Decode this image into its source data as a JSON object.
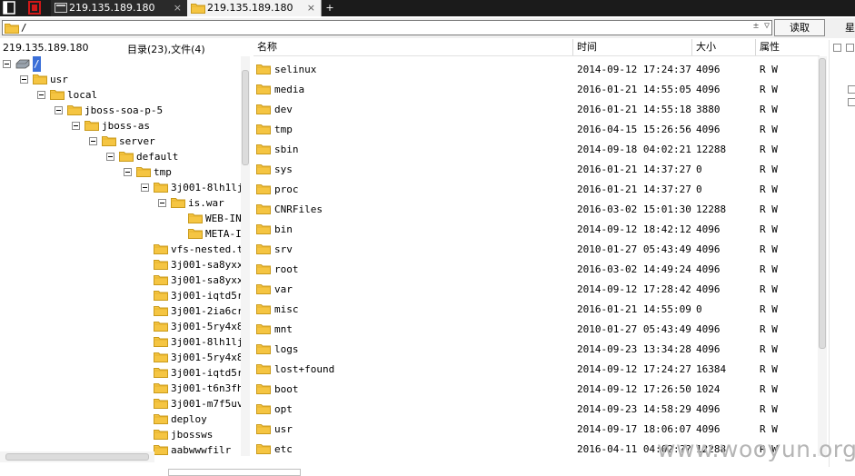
{
  "tabs": [
    {
      "label": "219.135.189.180",
      "active": false
    },
    {
      "label": "219.135.189.180",
      "active": true
    }
  ],
  "tab_close_glyph": "×",
  "tab_add_glyph": "+",
  "address": {
    "path": "/",
    "dropdown_glyph": "± ▽",
    "read_button": "读取",
    "side_char": "星"
  },
  "left_panel": {
    "host": "219.135.189.180",
    "dir_stats": "目录(23),文件(4)"
  },
  "tree": [
    {
      "label": "/",
      "depth": 0,
      "expanded": true,
      "icon": "drive-icon"
    },
    {
      "label": "usr",
      "depth": 1,
      "expanded": true
    },
    {
      "label": "local",
      "depth": 2,
      "expanded": true
    },
    {
      "label": "jboss-soa-p-5",
      "depth": 3,
      "expanded": true
    },
    {
      "label": "jboss-as",
      "depth": 4,
      "expanded": true
    },
    {
      "label": "server",
      "depth": 5,
      "expanded": true
    },
    {
      "label": "default",
      "depth": 6,
      "expanded": true
    },
    {
      "label": "tmp",
      "depth": 7,
      "expanded": true
    },
    {
      "label": "3j001-8lh1lj",
      "depth": 8,
      "expanded": true
    },
    {
      "label": "is.war",
      "depth": 9,
      "expanded": true
    },
    {
      "label": "WEB-IN",
      "depth": 10,
      "expanded": false
    },
    {
      "label": "META-I",
      "depth": 10,
      "expanded": false
    },
    {
      "label": "vfs-nested.tı",
      "depth": 8,
      "expanded": false
    },
    {
      "label": "3j001-sa8yxx",
      "depth": 8,
      "expanded": false
    },
    {
      "label": "3j001-sa8yxx",
      "depth": 8,
      "expanded": false
    },
    {
      "label": "3j001-iqtd5r",
      "depth": 8,
      "expanded": false
    },
    {
      "label": "3j001-2ia6cr",
      "depth": 8,
      "expanded": false
    },
    {
      "label": "3j001-5ry4x8",
      "depth": 8,
      "expanded": false
    },
    {
      "label": "3j001-8lh1lj",
      "depth": 8,
      "expanded": false
    },
    {
      "label": "3j001-5ry4x8",
      "depth": 8,
      "expanded": false
    },
    {
      "label": "3j001-iqtd5r",
      "depth": 8,
      "expanded": false
    },
    {
      "label": "3j001-t6n3fh",
      "depth": 8,
      "expanded": false
    },
    {
      "label": "3j001-m7f5uv",
      "depth": 8,
      "expanded": false
    },
    {
      "label": "deploy",
      "depth": 8,
      "expanded": false
    },
    {
      "label": "jbossws",
      "depth": 8,
      "expanded": false
    },
    {
      "label": "aabwwwfilr",
      "depth": 8,
      "expanded": false
    }
  ],
  "list_columns": {
    "name": "名称",
    "time": "时间",
    "size": "大小",
    "attr": "属性"
  },
  "files": [
    {
      "name": "selinux",
      "time": "2014-09-12 17:24:37",
      "size": "4096",
      "attr": "R W"
    },
    {
      "name": "media",
      "time": "2016-01-21 14:55:05",
      "size": "4096",
      "attr": "R W"
    },
    {
      "name": "dev",
      "time": "2016-01-21 14:55:18",
      "size": "3880",
      "attr": "R W"
    },
    {
      "name": "tmp",
      "time": "2016-04-15 15:26:56",
      "size": "4096",
      "attr": "R W"
    },
    {
      "name": "sbin",
      "time": "2014-09-18 04:02:21",
      "size": "12288",
      "attr": "R W"
    },
    {
      "name": "sys",
      "time": "2016-01-21 14:37:27",
      "size": "0",
      "attr": "R W"
    },
    {
      "name": "proc",
      "time": "2016-01-21 14:37:27",
      "size": "0",
      "attr": "R W"
    },
    {
      "name": "CNRFiles",
      "time": "2016-03-02 15:01:30",
      "size": "12288",
      "attr": "R W"
    },
    {
      "name": "bin",
      "time": "2014-09-12 18:42:12",
      "size": "4096",
      "attr": "R W"
    },
    {
      "name": "srv",
      "time": "2010-01-27 05:43:49",
      "size": "4096",
      "attr": "R W"
    },
    {
      "name": "root",
      "time": "2016-03-02 14:49:24",
      "size": "4096",
      "attr": "R W"
    },
    {
      "name": "var",
      "time": "2014-09-12 17:28:42",
      "size": "4096",
      "attr": "R W"
    },
    {
      "name": "misc",
      "time": "2016-01-21 14:55:09",
      "size": "0",
      "attr": "R W"
    },
    {
      "name": "mnt",
      "time": "2010-01-27 05:43:49",
      "size": "4096",
      "attr": "R W"
    },
    {
      "name": "logs",
      "time": "2014-09-23 13:34:28",
      "size": "4096",
      "attr": "R W"
    },
    {
      "name": "lost+found",
      "time": "2014-09-12 17:24:27",
      "size": "16384",
      "attr": "R W"
    },
    {
      "name": "boot",
      "time": "2014-09-12 17:26:50",
      "size": "1024",
      "attr": "R W"
    },
    {
      "name": "opt",
      "time": "2014-09-23 14:58:29",
      "size": "4096",
      "attr": "R W"
    },
    {
      "name": "usr",
      "time": "2014-09-17 18:06:07",
      "size": "4096",
      "attr": "R W"
    },
    {
      "name": "etc",
      "time": "2016-04-11 04:02:??",
      "size": "12288",
      "attr": "R W"
    }
  ],
  "watermark": "www.wooyun.org",
  "colors": {
    "folder": "#f5c542",
    "folder_edge": "#c99a1a",
    "titlebar": "#1b1b1b",
    "app_icon": "#d01818"
  }
}
